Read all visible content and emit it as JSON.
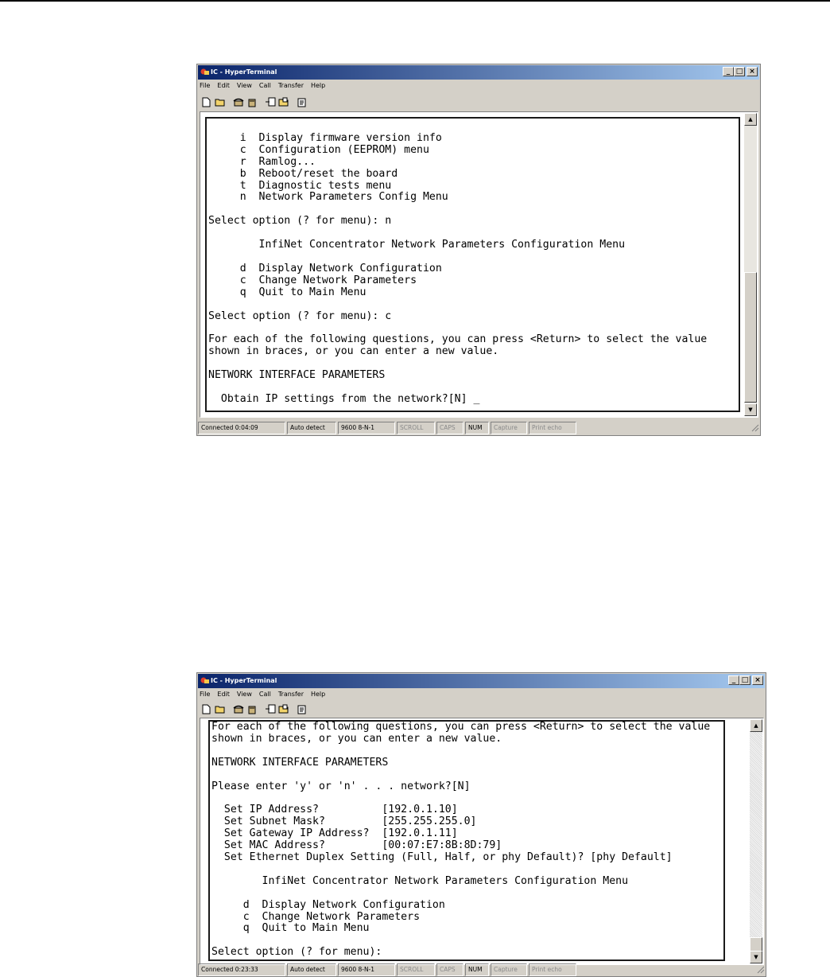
{
  "windows": [
    {
      "title": "IC - HyperTerminal",
      "menus": [
        "File",
        "Edit",
        "View",
        "Call",
        "Transfer",
        "Help"
      ],
      "minimize": "_",
      "maximize": "□",
      "close": "×",
      "toolbar_icons": [
        "new-document-icon",
        "open-folder-icon",
        "phone-connect-icon",
        "phone-disconnect-icon",
        "send-file-icon",
        "receive-file-icon",
        "properties-icon"
      ],
      "terminal_lines": [
        "",
        "     i  Display firmware version info",
        "     c  Configuration (EEPROM) menu",
        "     r  Ramlog...",
        "     b  Reboot/reset the board",
        "     t  Diagnostic tests menu",
        "     n  Network Parameters Config Menu",
        "",
        "Select option (? for menu): n",
        "",
        "        InfiNet Concentrator Network Parameters Configuration Menu",
        "",
        "     d  Display Network Configuration",
        "     c  Change Network Parameters",
        "     q  Quit to Main Menu",
        "",
        "Select option (? for menu): c",
        "",
        "For each of the following questions, you can press <Return> to select the value",
        "shown in braces, or you can enter a new value.",
        "",
        "NETWORK INTERFACE PARAMETERS",
        "",
        "  Obtain IP settings from the network?[N] _"
      ],
      "status": [
        "Connected 0:04:09",
        "Auto detect",
        "9600 8-N-1",
        "SCROLL",
        "CAPS",
        "NUM",
        "Capture",
        "Print echo"
      ]
    },
    {
      "title": "IC - HyperTerminal",
      "menus": [
        "File",
        "Edit",
        "View",
        "Call",
        "Transfer",
        "Help"
      ],
      "minimize": "_",
      "maximize": "□",
      "close": "×",
      "toolbar_icons": [
        "new-document-icon",
        "open-folder-icon",
        "phone-connect-icon",
        "phone-disconnect-icon",
        "send-file-icon",
        "receive-file-icon",
        "properties-icon"
      ],
      "terminal_lines": [
        "For each of the following questions, you can press <Return> to select the value",
        "shown in braces, or you can enter a new value.",
        "",
        "NETWORK INTERFACE PARAMETERS",
        "",
        "Please enter 'y' or 'n' . . . network?[N]",
        "",
        "  Set IP Address?          [192.0.1.10]",
        "  Set Subnet Mask?         [255.255.255.0]",
        "  Set Gateway IP Address?  [192.0.1.11]",
        "  Set MAC Address?         [00:07:E7:8B:8D:79]",
        "  Set Ethernet Duplex Setting (Full, Half, or phy Default)? [phy Default]",
        "",
        "        InfiNet Concentrator Network Parameters Configuration Menu",
        "",
        "     d  Display Network Configuration",
        "     c  Change Network Parameters",
        "     q  Quit to Main Menu",
        "",
        "Select option (? for menu):"
      ],
      "status": [
        "Connected 0:23:33",
        "Auto detect",
        "9600 8-N-1",
        "SCROLL",
        "CAPS",
        "NUM",
        "Capture",
        "Print echo"
      ]
    }
  ]
}
